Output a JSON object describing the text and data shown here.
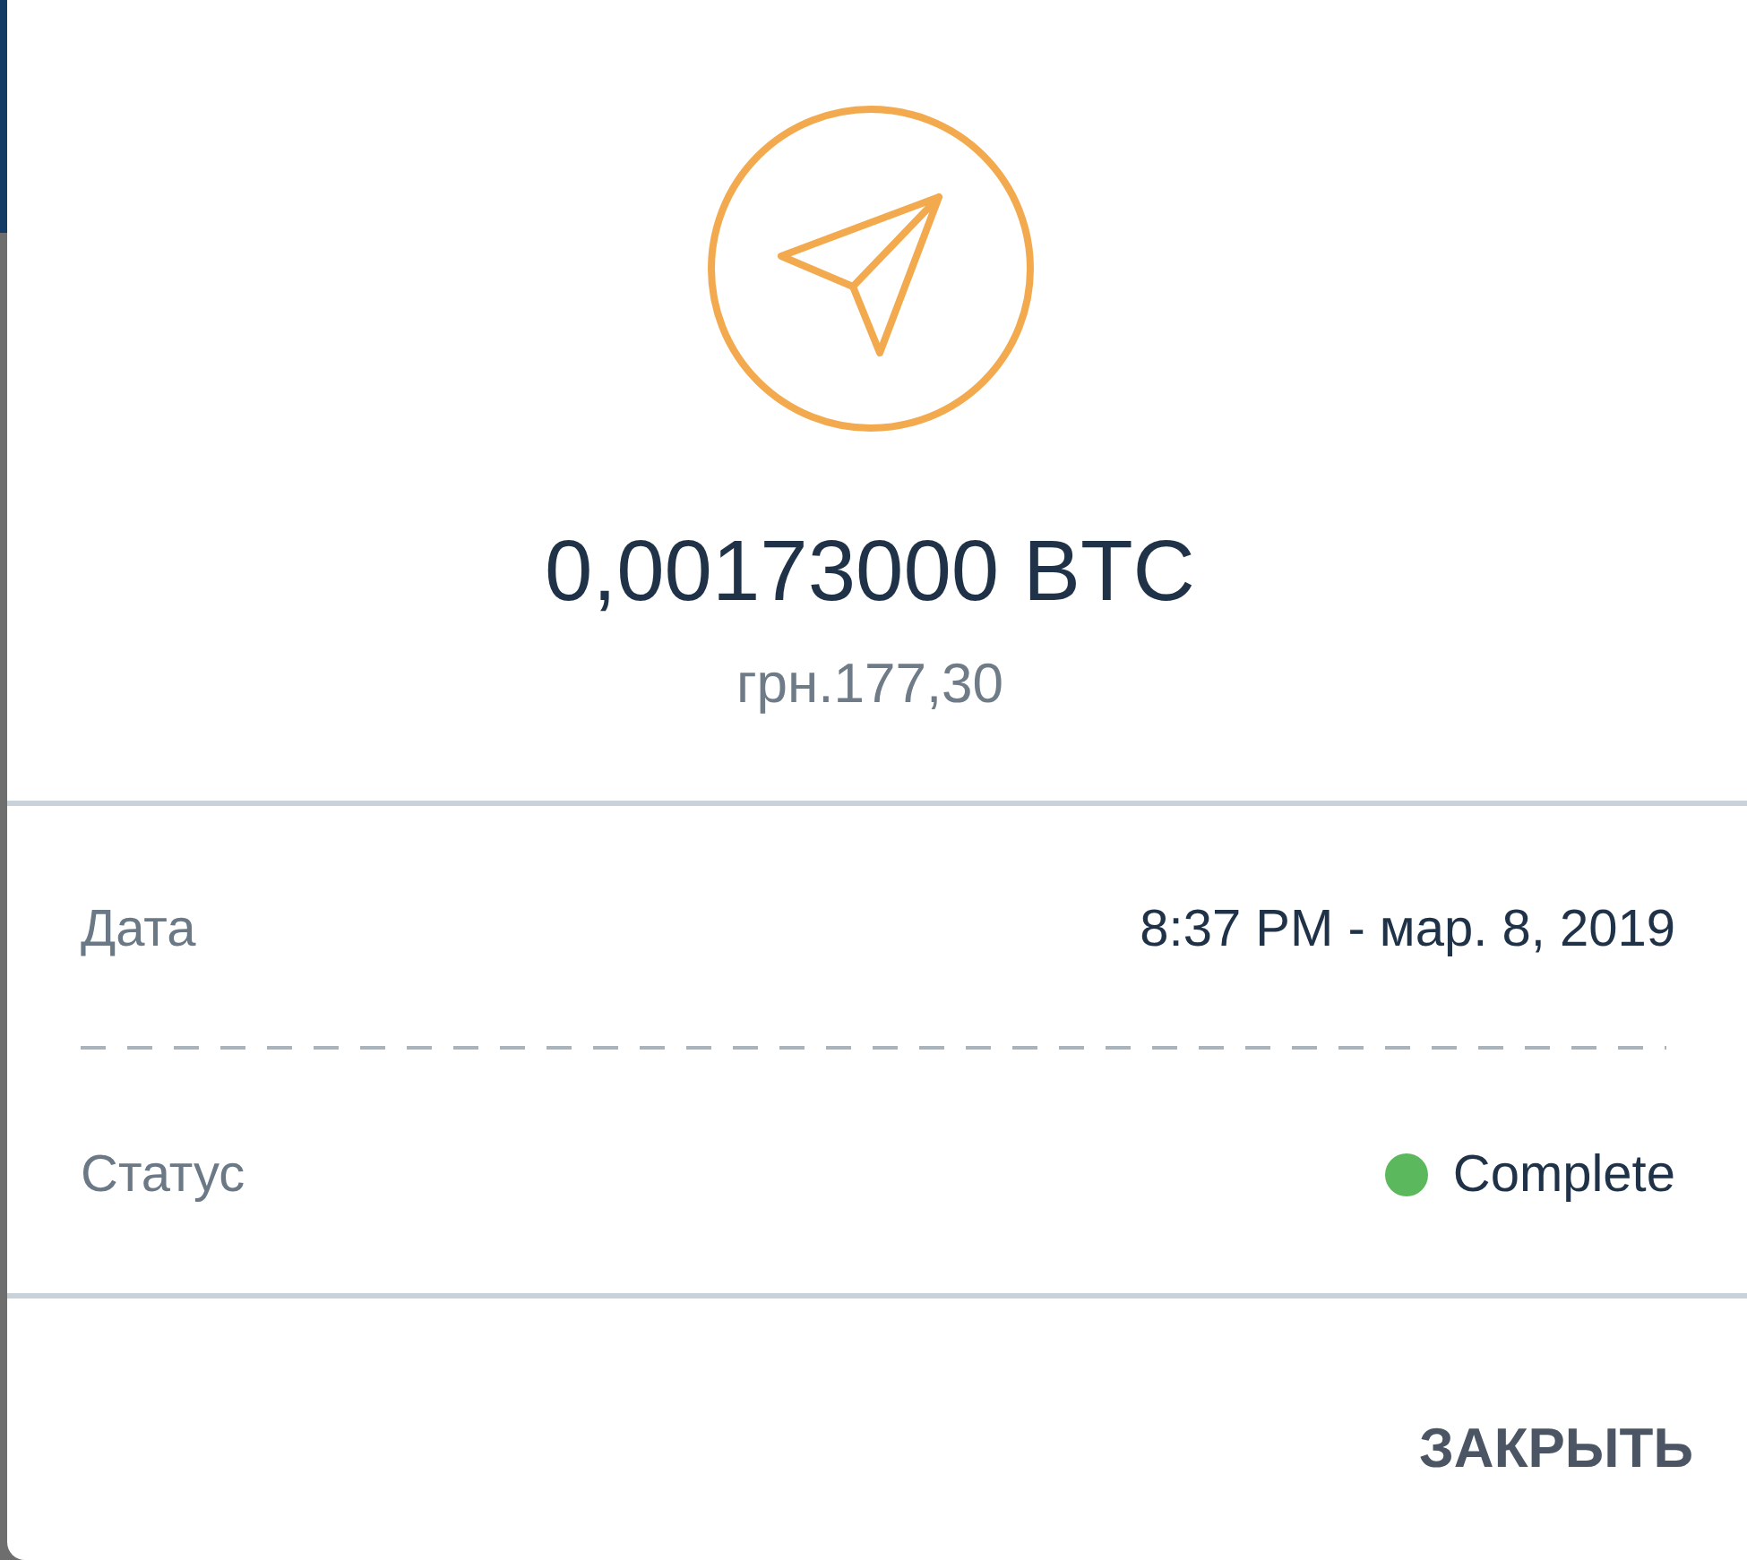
{
  "amount": {
    "crypto": "0,00173000 BTC",
    "fiat": "грн.177,30"
  },
  "details": [
    {
      "kind": "text",
      "label": "Дата",
      "value": "8:37 PM - мар. 8, 2019"
    },
    {
      "kind": "status",
      "label": "Статус",
      "value": "Complete",
      "color": "#5cb85c"
    }
  ],
  "buttons": [
    {
      "label": "ЗАКРЫТЬ"
    }
  ]
}
